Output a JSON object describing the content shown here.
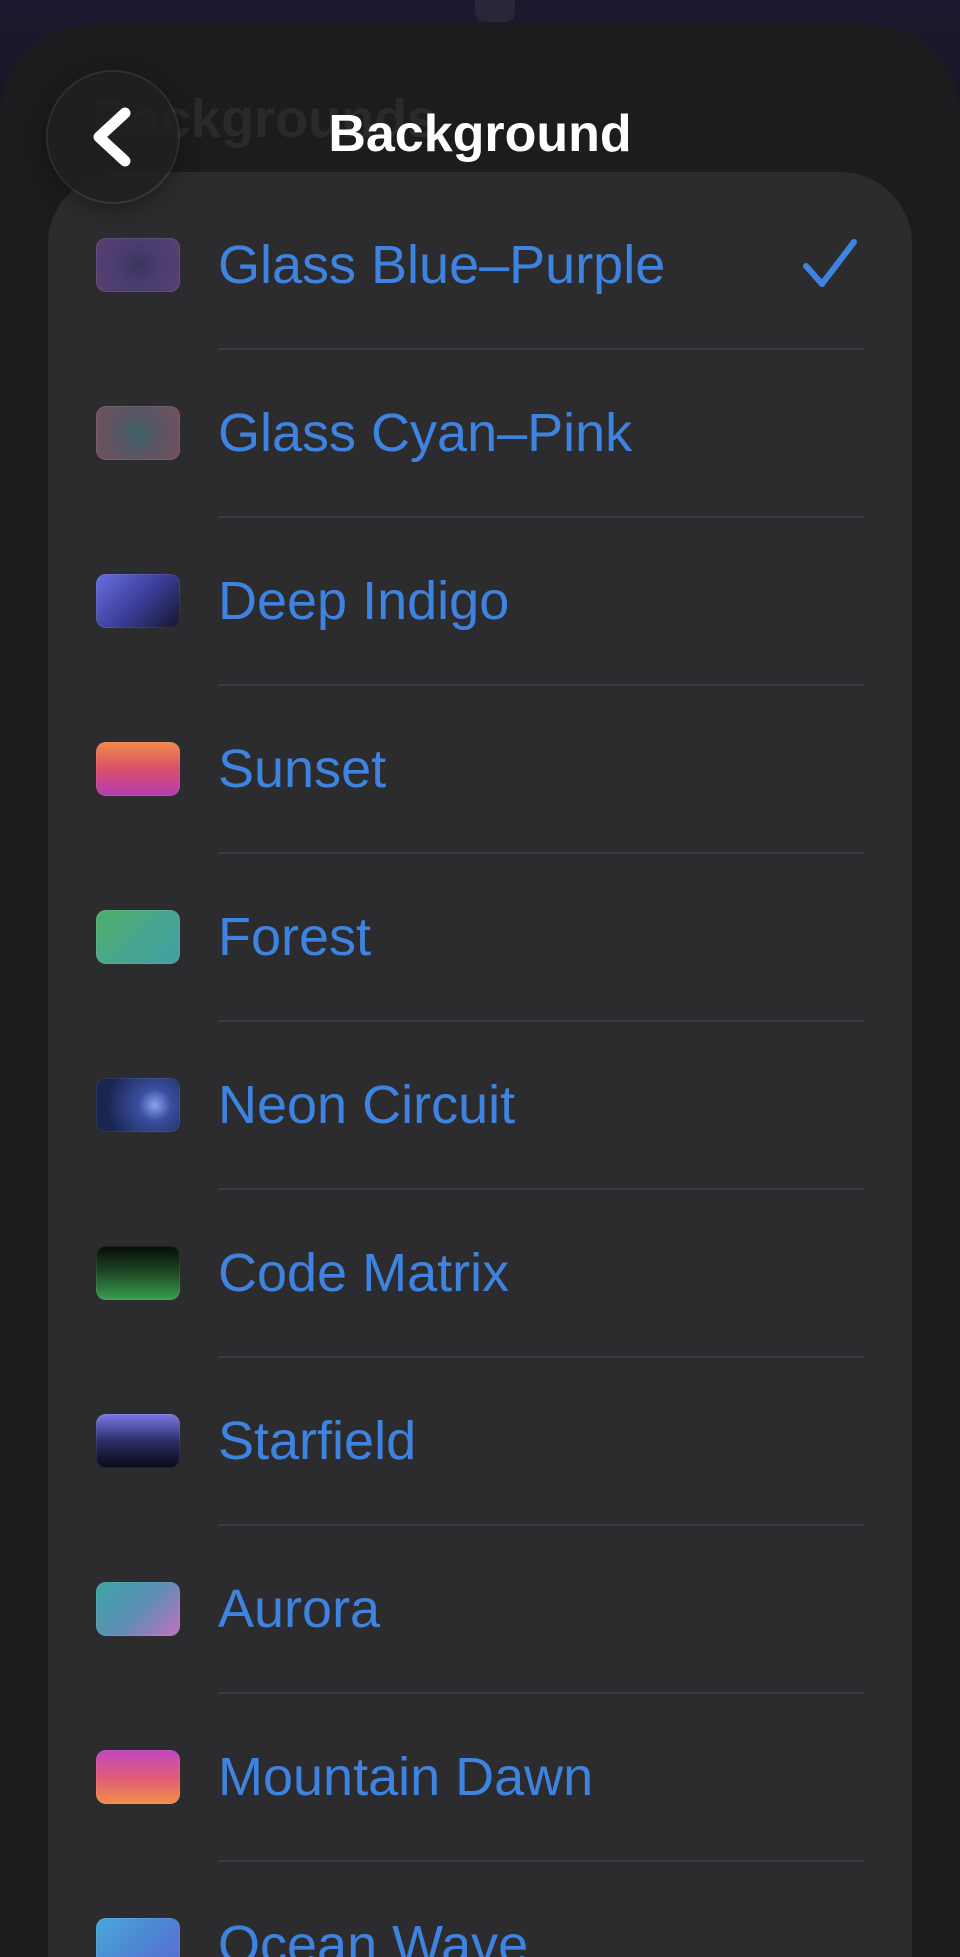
{
  "header": {
    "title": "Background",
    "underlay_title": "Backgrounds",
    "back_icon": "chevron-left-icon"
  },
  "list": {
    "selected": "Glass Blue–Purple",
    "items": [
      {
        "label": "Glass Blue–Purple",
        "id": "glass-blue-purple",
        "selected": true,
        "colors": [
          "#3a3560",
          "#4a3d6e",
          "#5a3f72"
        ]
      },
      {
        "label": "Glass Cyan–Pink",
        "id": "glass-cyan-pink",
        "selected": false,
        "colors": [
          "#3d6168",
          "#5a5562",
          "#74505e"
        ]
      },
      {
        "label": "Deep Indigo",
        "id": "deep-indigo",
        "selected": false,
        "colors": [
          "#6a6fe0",
          "#3d3f9a",
          "#15152c"
        ]
      },
      {
        "label": "Sunset",
        "id": "sunset",
        "selected": false,
        "colors": [
          "#f08a4a",
          "#d9506a",
          "#b43cb4"
        ]
      },
      {
        "label": "Forest",
        "id": "forest",
        "selected": false,
        "colors": [
          "#4fae6a",
          "#49a68c",
          "#3fa0a6"
        ]
      },
      {
        "label": "Neon Circuit",
        "id": "neon-circuit",
        "selected": false,
        "colors": [
          "#1a2550",
          "#3a4e9e",
          "#6a7edf"
        ]
      },
      {
        "label": "Code Matrix",
        "id": "code-matrix",
        "selected": false,
        "colors": [
          "#060a08",
          "#1e4a26",
          "#3aa050"
        ]
      },
      {
        "label": "Starfield",
        "id": "starfield",
        "selected": false,
        "colors": [
          "#7a7ae8",
          "#2c2c66",
          "#0a0a16"
        ]
      },
      {
        "label": "Aurora",
        "id": "aurora",
        "selected": false,
        "colors": [
          "#3ea6a4",
          "#5a8fb4",
          "#c070c0"
        ]
      },
      {
        "label": "Mountain Dawn",
        "id": "mountain-dawn",
        "selected": false,
        "colors": [
          "#c048c0",
          "#e05a7a",
          "#f09044"
        ]
      },
      {
        "label": "Ocean Wave",
        "id": "ocean-wave",
        "selected": false,
        "colors": [
          "#48a8d8",
          "#4e86d4",
          "#5a6ad0"
        ]
      }
    ]
  },
  "colors": {
    "label": "#3f83e0",
    "check": "#3f83e0",
    "sheet": "#1c1c1e",
    "card": "#2c2c2e",
    "divider": "#3c3c40",
    "header_title": "#ffffff"
  }
}
